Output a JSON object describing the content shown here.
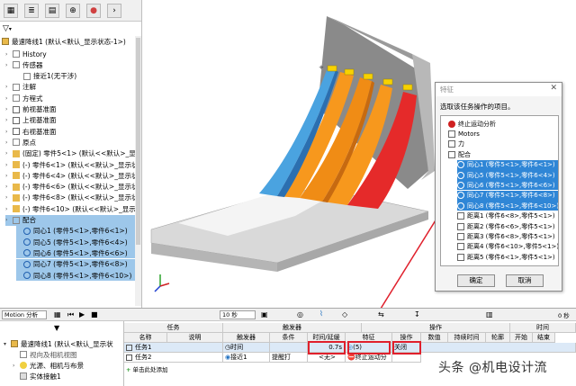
{
  "tree": {
    "top_item": "最速降线1 (默认<默认_显示状态-1>)",
    "items": [
      {
        "label": "History",
        "icon": "history-icon",
        "color": "#ffffff"
      },
      {
        "label": "传感器",
        "icon": "sensor-icon",
        "color": "#ffffff"
      },
      {
        "label": "接近1(无干涉)",
        "icon": "proximity-icon",
        "color": "#ffffff",
        "indent": true
      },
      {
        "label": "注解",
        "icon": "annotation-icon",
        "color": "#ffffff"
      },
      {
        "label": "方程式",
        "icon": "equation-icon",
        "color": "#ffffff"
      },
      {
        "label": "前视基准面",
        "icon": "plane-icon",
        "color": "#ffffff"
      },
      {
        "label": "上视基准面",
        "icon": "plane-icon",
        "color": "#ffffff"
      },
      {
        "label": "右视基准面",
        "icon": "plane-icon",
        "color": "#ffffff"
      },
      {
        "label": "原点",
        "icon": "origin-icon",
        "color": "#ffffff"
      },
      {
        "label": "(固定) 零件5<1> (默认<<默认>_显示状",
        "icon": "part-icon",
        "color": "#ffffff"
      },
      {
        "label": "(-) 零件6<1> (默认<<默认>_显示状态",
        "icon": "part-icon",
        "color": "#ffffff"
      },
      {
        "label": "(-) 零件6<4> (默认<<默认>_显示状态",
        "icon": "part-icon",
        "color": "#ffffff"
      },
      {
        "label": "(-) 零件6<6> (默认<<默认>_显示状态",
        "icon": "part-icon",
        "color": "#ffffff"
      },
      {
        "label": "(-) 零件6<8> (默认<<默认>_显示状态",
        "icon": "part-icon",
        "color": "#ffffff"
      },
      {
        "label": "(-) 零件6<10> (默认<<默认>_显示状态",
        "icon": "part-icon",
        "color": "#ffffff"
      },
      {
        "label": "配合",
        "icon": "mate-icon",
        "color": "#9dc7ea"
      },
      {
        "label": "同心1 (零件5<1>,零件6<1>)",
        "icon": "concentric-icon",
        "color": "#9dc7ea",
        "indent": true
      },
      {
        "label": "同心5 (零件5<1>,零件6<4>)",
        "icon": "concentric-icon",
        "color": "#9dc7ea",
        "indent": true
      },
      {
        "label": "同心6 (零件5<1>,零件6<6>)",
        "icon": "concentric-icon",
        "color": "#9dc7ea",
        "indent": true
      },
      {
        "label": "同心7 (零件5<1>,零件6<8>)",
        "icon": "concentric-icon",
        "color": "#9dc7ea",
        "indent": true
      },
      {
        "label": "同心8 (零件5<1>,零件6<10>)",
        "icon": "concentric-icon",
        "color": "#9dc7ea",
        "indent": true
      }
    ]
  },
  "dialog": {
    "title": "特征",
    "prompt": "选取该任务操作的项目。",
    "items": [
      {
        "label": "终止运动分析",
        "icon": "stop-icon"
      },
      {
        "label": "Motors",
        "icon": "motor-icon"
      },
      {
        "label": "力",
        "icon": "force-icon"
      },
      {
        "label": "配合",
        "icon": "mate-icon"
      },
      {
        "label": "同心1 (零件5<1>,零件6<1>)",
        "icon": "concentric-icon",
        "selected": true
      },
      {
        "label": "同心5 (零件5<1>,零件6<4>)",
        "icon": "concentric-icon",
        "selected": true
      },
      {
        "label": "同心6 (零件5<1>,零件6<6>)",
        "icon": "concentric-icon",
        "selected": true
      },
      {
        "label": "同心7 (零件5<1>,零件6<8>)",
        "icon": "concentric-icon",
        "selected": true
      },
      {
        "label": "同心8 (零件5<1>,零件6<10>)",
        "icon": "concentric-icon",
        "selected": true
      },
      {
        "label": "距离1 (零件6<8>,零件5<1>)",
        "icon": "distance-icon"
      },
      {
        "label": "距离2 (零件6<6>,零件5<1>)",
        "icon": "distance-icon"
      },
      {
        "label": "距离3 (零件6<8>,零件5<1>)",
        "icon": "distance-icon"
      },
      {
        "label": "距离4 (零件6<10>,零件5<1>)",
        "icon": "distance-icon"
      },
      {
        "label": "距离5 (零件6<1>,零件5<1>)",
        "icon": "distance-icon"
      }
    ],
    "ok": "确定",
    "cancel": "取消"
  },
  "bottom": {
    "study_type": "Motion 分析",
    "time_value": "10 秒",
    "tree_items": [
      "最速降线1 (默认<默认_显示状",
      "视向及相机视图",
      "光源、相机与布景",
      "实体接触1"
    ],
    "headers": {
      "task": "任务",
      "trigger": "触发器",
      "operation": "操作",
      "time": "时间",
      "name": "名称",
      "desc": "说明",
      "trigger_col": "触发器",
      "condition": "条件",
      "time_delay": "时间/延缓",
      "feature": "特征",
      "op": "操作",
      "value": "数值",
      "duration": "持续时间",
      "profile": "轮廓",
      "start": "开始",
      "end": "结束",
      "zero": "0 秒"
    },
    "rows": [
      {
        "name": "任务1",
        "trigger": "时间",
        "condition": "",
        "delay": "0.7s",
        "feature": "(5)",
        "op": "关闭"
      },
      {
        "name": "任务2",
        "trigger": "接近1",
        "condition": "提醒打",
        "delay": "<无>",
        "feature": "终止运动分",
        "op": ""
      }
    ],
    "add_row": "单击此处添加"
  },
  "watermark": "头条 @机电设计流",
  "colors": {
    "selection": "#9dc7ea",
    "red_box": "#e0202c",
    "orange": "#f7981d",
    "red": "#e52a2a",
    "blue": "#4aa3e0",
    "gray": "#8d8d8d"
  }
}
